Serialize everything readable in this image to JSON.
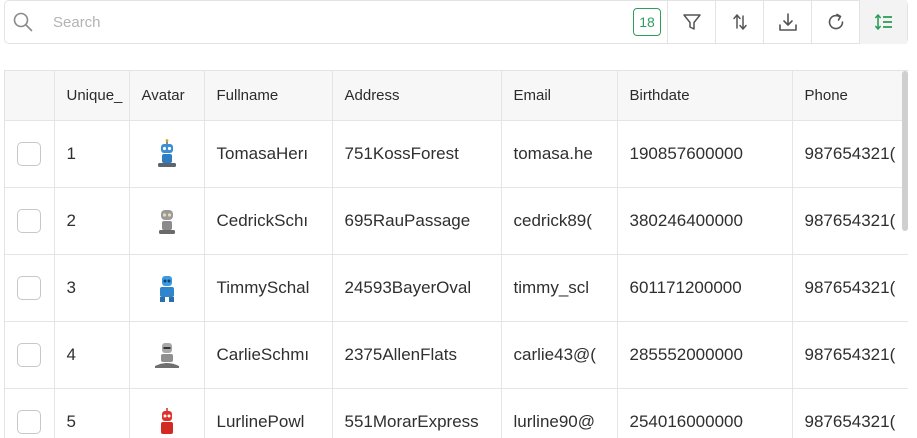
{
  "toolbar": {
    "search_placeholder": "Search",
    "row_count": "18",
    "buttons": [
      {
        "icon": "filter-icon"
      },
      {
        "icon": "sort-icon"
      },
      {
        "icon": "download-icon"
      },
      {
        "icon": "refresh-icon"
      },
      {
        "icon": "row-height-icon"
      }
    ],
    "accent_color": "#2e9e5b"
  },
  "grid": {
    "columns": [
      "Unique_",
      "Avatar",
      "Fullname",
      "Address",
      "Email",
      "Birthdate",
      "Phone"
    ],
    "rows": [
      {
        "id": "1",
        "avatar": "robot-avatar-blue",
        "fullname": "TomasaHerı",
        "address": "751KossForest",
        "email": "tomasa.he",
        "birthdate": "190857600000",
        "phone": "987654321("
      },
      {
        "id": "2",
        "avatar": "robot-avatar-gray",
        "fullname": "CedrickSchı",
        "address": "695RauPassage",
        "email": "cedrick89(",
        "birthdate": "380246400000",
        "phone": "987654321("
      },
      {
        "id": "3",
        "avatar": "robot-avatar-blue",
        "fullname": "TimmySchal",
        "address": "24593BayerOval",
        "email": "timmy_scl",
        "birthdate": "601171200000",
        "phone": "987654321("
      },
      {
        "id": "4",
        "avatar": "robot-avatar-gray",
        "fullname": "CarlieSchmı",
        "address": "2375AllenFlats",
        "email": "carlie43@(",
        "birthdate": "285552000000",
        "phone": "987654321("
      },
      {
        "id": "5",
        "avatar": "robot-avatar-red",
        "fullname": "LurlinePowl",
        "address": "551MorarExpress",
        "email": "lurline90@",
        "birthdate": "254016000000",
        "phone": "987654321("
      }
    ]
  }
}
